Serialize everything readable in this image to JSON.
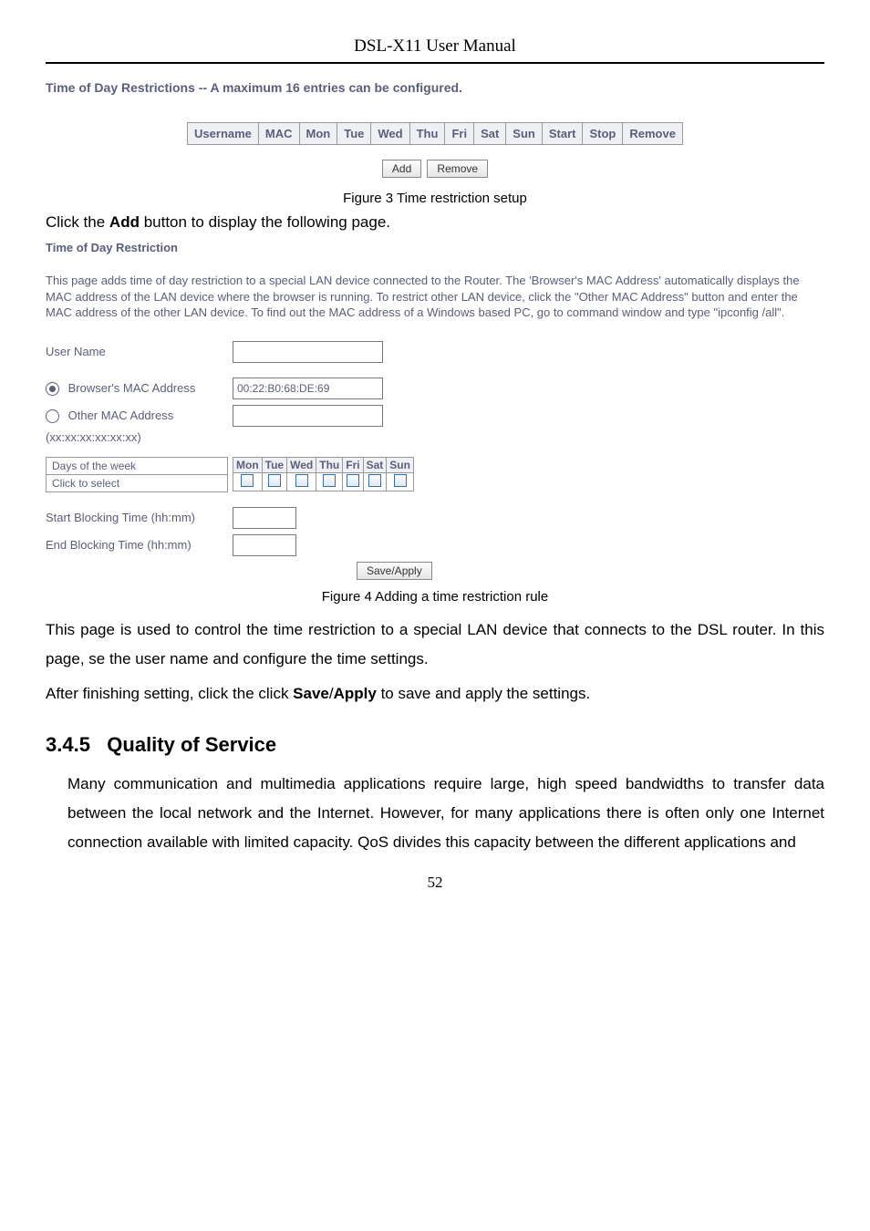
{
  "header": {
    "title": "DSL-X11 User Manual"
  },
  "section1": {
    "title": "Time of Day Restrictions -- A maximum 16 entries can be configured.",
    "columns": [
      "Username",
      "MAC",
      "Mon",
      "Tue",
      "Wed",
      "Thu",
      "Fri",
      "Sat",
      "Sun",
      "Start",
      "Stop",
      "Remove"
    ],
    "buttons": {
      "add": "Add",
      "remove": "Remove"
    },
    "caption": "Figure 3 Time restriction setup"
  },
  "line_click_add": {
    "prefix": "Click the ",
    "bold": "Add",
    "suffix": " button to display the following page."
  },
  "section2": {
    "title": "Time of Day Restriction",
    "info": "This page adds time of day restriction to a special LAN device connected to the Router. The 'Browser's MAC Address' automatically displays the MAC address of the LAN device where the browser is running. To restrict other LAN device, click the \"Other MAC Address\" button and enter the MAC address of the other LAN device. To find out the MAC address of a Windows based PC, go to command window and type \"ipconfig /all\".",
    "user_name_label": "User Name",
    "user_name_value": "",
    "browser_mac_label": "Browser's MAC Address",
    "browser_mac_value": "00:22:B0:68:DE:69",
    "other_mac_label": "Other MAC Address",
    "other_mac_hint": "(xx:xx:xx:xx:xx:xx)",
    "other_mac_value": "",
    "days_row1": "Days of the week",
    "days_row2": "Click to select",
    "days": [
      "Mon",
      "Tue",
      "Wed",
      "Thu",
      "Fri",
      "Sat",
      "Sun"
    ],
    "start_label": "Start Blocking Time (hh:mm)",
    "start_value": "",
    "end_label": "End Blocking Time (hh:mm)",
    "end_value": "",
    "save_btn": "Save/Apply",
    "caption": "Figure 4 Adding a time restriction rule"
  },
  "para1": "This page is used to control the time restriction to a special LAN device that connects to the DSL router. In this page, se the user name and configure the time settings.",
  "para2": {
    "prefix": "After finishing setting, click the click ",
    "b1": "Save",
    "mid": "/",
    "b2": "Apply",
    "suffix": " to save and apply the settings."
  },
  "h2": {
    "num": "3.4.5",
    "title": "Quality of Service"
  },
  "para3": "Many communication and multimedia applications require large, high speed bandwidths to transfer data between the local network and the Internet. However, for many applications there is often only one Internet connection available with limited capacity. QoS divides this capacity between the different applications and",
  "page_num": "52"
}
